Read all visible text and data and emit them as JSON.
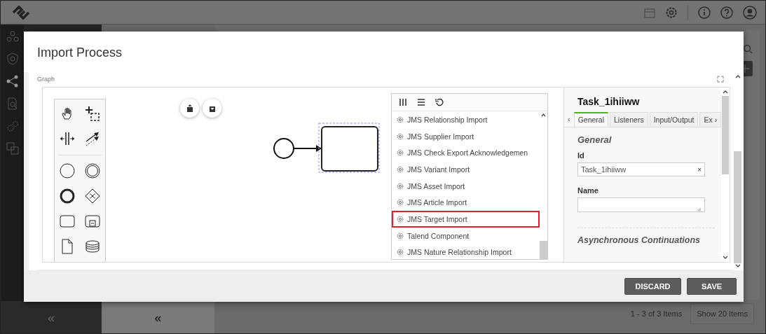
{
  "background": {
    "collapse_left": "«",
    "collapse_list": "«",
    "pagination": {
      "summary": "1 - 3 of 3 Items",
      "page_size": "Show 20 Items"
    }
  },
  "modal": {
    "title": "Import Process",
    "graph_label": "Graph",
    "element_menu": {
      "items": [
        {
          "label": "JMS Relationship Import",
          "highlighted": false
        },
        {
          "label": "JMS Supplier Import",
          "highlighted": false
        },
        {
          "label": "JMS Check Export Acknowledgemen",
          "highlighted": false
        },
        {
          "label": "JMS Variant Import",
          "highlighted": false
        },
        {
          "label": "JMS Asset Import",
          "highlighted": false
        },
        {
          "label": "JMS Article Import",
          "highlighted": false
        },
        {
          "label": "JMS Target Import",
          "highlighted": true
        },
        {
          "label": "Talend Component",
          "highlighted": false
        },
        {
          "label": "JMS Nature Relationship Import",
          "highlighted": false
        }
      ]
    },
    "properties": {
      "title": "Task_1ihiiww",
      "tab_prev": "‹",
      "tab_next": "›",
      "tabs": [
        {
          "label": "General",
          "selected": true
        },
        {
          "label": "Listeners",
          "selected": false
        },
        {
          "label": "Input/Output",
          "selected": false
        },
        {
          "label": "Ex",
          "selected": false
        }
      ],
      "section_title": "General",
      "fields": [
        {
          "kind": "text",
          "label": "Id",
          "value": "Task_1ihiiww",
          "clear": "×"
        },
        {
          "kind": "textarea",
          "label": "Name"
        }
      ],
      "next_section": "Asynchronous Continuations"
    },
    "buttons": [
      {
        "label": "DISCARD"
      },
      {
        "label": "SAVE"
      }
    ]
  }
}
